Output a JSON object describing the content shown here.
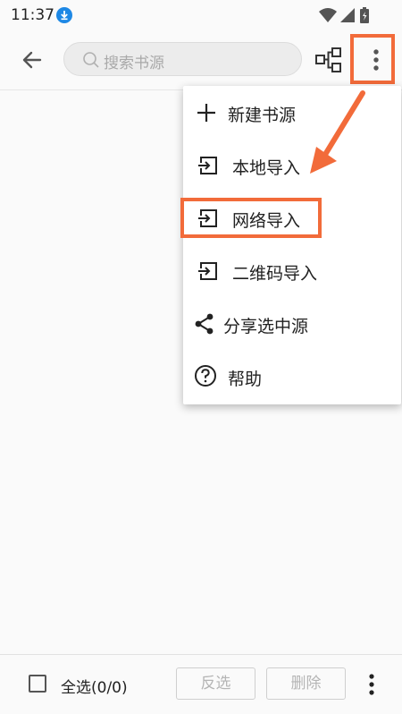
{
  "status_bar": {
    "time": "11:37"
  },
  "toolbar": {
    "search_placeholder": "搜索书源"
  },
  "menu": {
    "items": [
      {
        "label": "新建书源",
        "icon": "plus-icon"
      },
      {
        "label": "本地导入",
        "icon": "import-icon"
      },
      {
        "label": "网络导入",
        "icon": "import-icon"
      },
      {
        "label": "二维码导入",
        "icon": "import-icon"
      },
      {
        "label": "分享选中源",
        "icon": "share-icon"
      },
      {
        "label": "帮助",
        "icon": "help-icon"
      }
    ]
  },
  "bottom_bar": {
    "select_all_label": "全选(0/0)",
    "invert_label": "反选",
    "delete_label": "删除"
  },
  "colors": {
    "annotation": "#f26b3a"
  }
}
